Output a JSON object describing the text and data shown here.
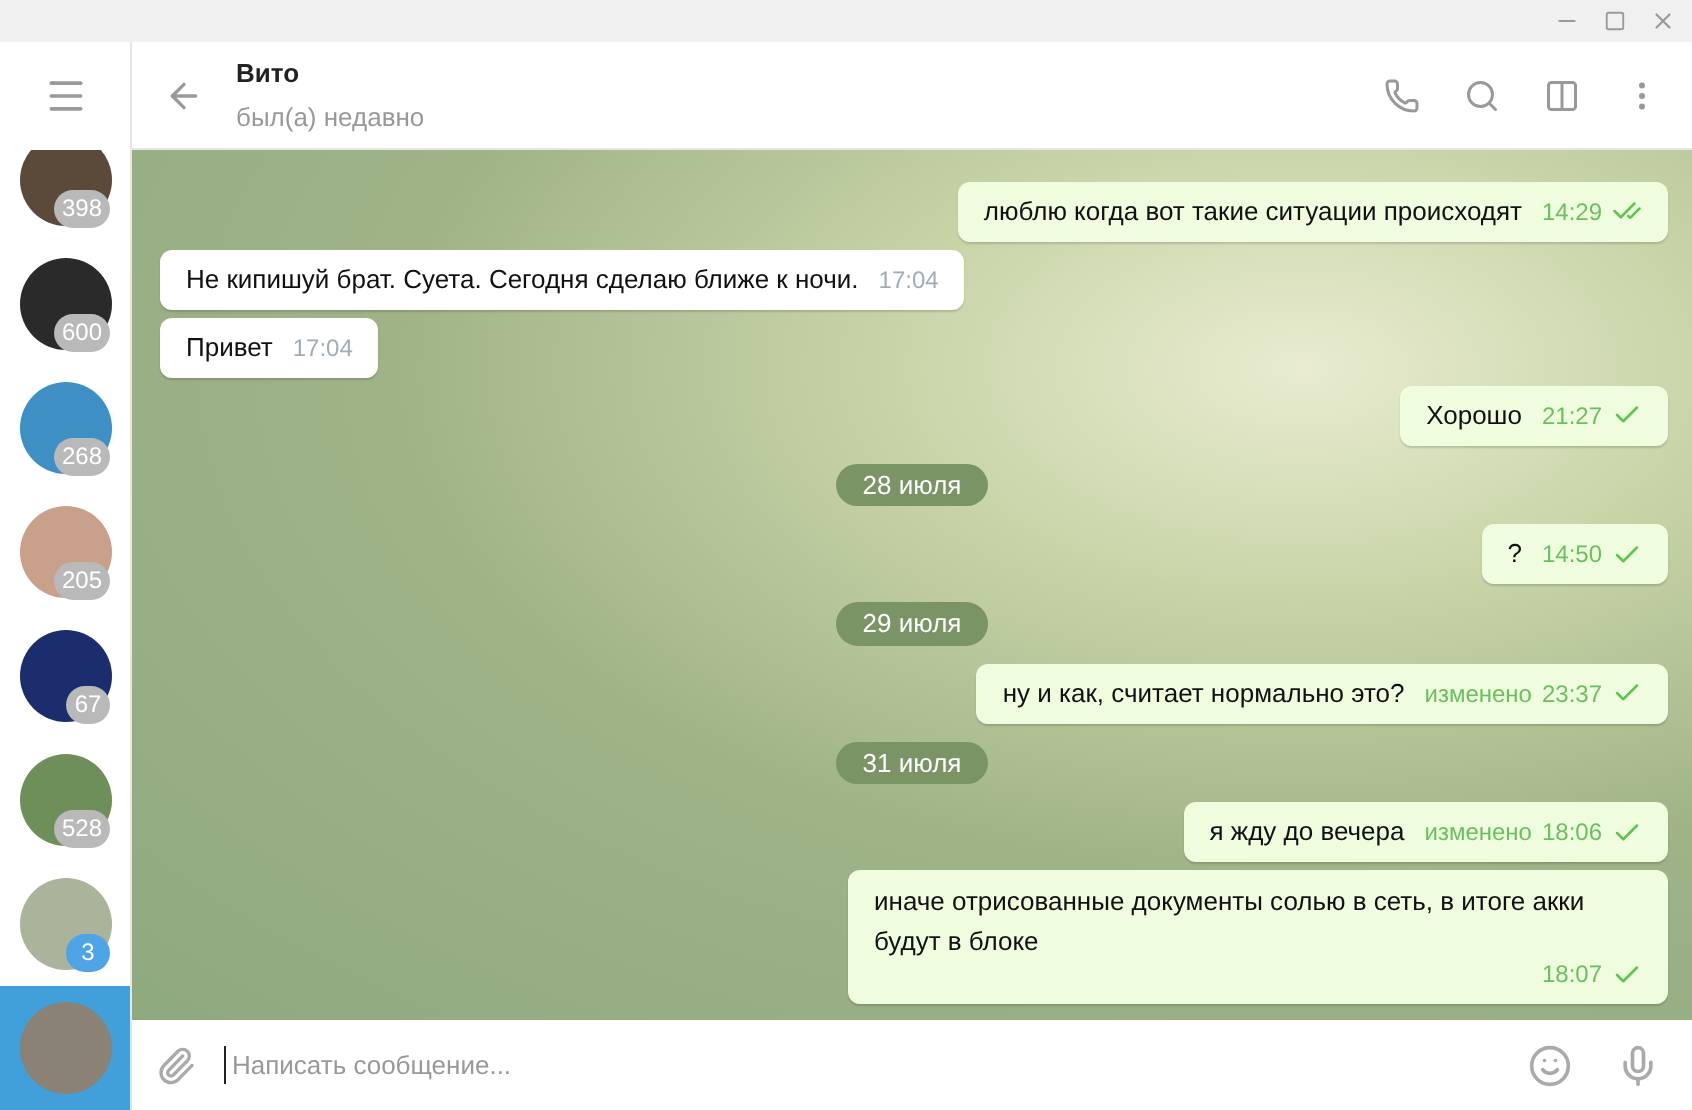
{
  "chat": {
    "name": "Вито",
    "status": "был(а) недавно"
  },
  "dialogs": [
    {
      "badge": "398",
      "muted": true,
      "selected": false
    },
    {
      "badge": "600",
      "muted": true,
      "selected": false
    },
    {
      "badge": "268",
      "muted": true,
      "selected": false
    },
    {
      "badge": "205",
      "muted": true,
      "selected": false
    },
    {
      "badge": "67",
      "muted": true,
      "selected": false
    },
    {
      "badge": "528",
      "muted": true,
      "selected": false
    },
    {
      "badge": "3",
      "muted": false,
      "selected": false
    },
    {
      "selected": true
    }
  ],
  "messages": [
    {
      "kind": "out",
      "text": "люблю когда вот такие ситуации происходят",
      "time": "14:29",
      "read": true
    },
    {
      "kind": "in",
      "text": "Не кипишуй брат. Суета. Сегодня сделаю ближе к ночи.",
      "time": "17:04"
    },
    {
      "kind": "in",
      "text": "Привет",
      "time": "17:04"
    },
    {
      "kind": "out",
      "text": "Хорошо",
      "time": "21:27",
      "read": false
    },
    {
      "kind": "date",
      "text": "28 июля"
    },
    {
      "kind": "out",
      "text": "?",
      "time": "14:50",
      "read": false
    },
    {
      "kind": "date",
      "text": "29 июля"
    },
    {
      "kind": "out",
      "text": "ну и как, считает нормально это?",
      "edited": "изменено",
      "time": "23:37",
      "read": false
    },
    {
      "kind": "date",
      "text": "31 июля"
    },
    {
      "kind": "out",
      "text": "я жду до вечера",
      "edited": "изменено",
      "time": "18:06",
      "read": false
    },
    {
      "kind": "out",
      "text": "иначе отрисованные документы солью в сеть, в итоге акки будут в блоке",
      "time": "18:07",
      "read": false
    }
  ],
  "composer": {
    "placeholder": "Написать сообщение..."
  }
}
